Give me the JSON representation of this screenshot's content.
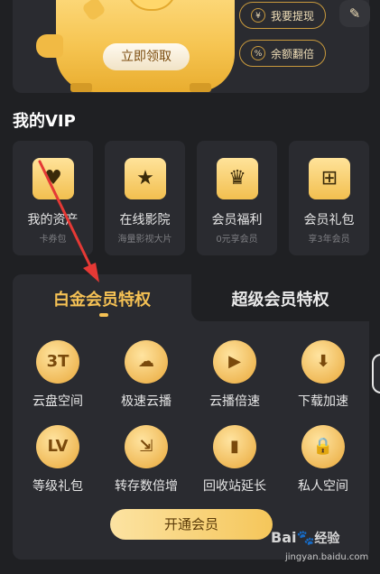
{
  "banner": {
    "claim_label": "立即领取",
    "withdraw_label": "我要提现",
    "withdraw_icon": "¥",
    "double_label": "余额翻倍",
    "double_icon": "%",
    "edit_icon": "edit-icon"
  },
  "vip": {
    "title": "我的VIP",
    "cards": [
      {
        "label": "我的资产",
        "sub": "卡券包",
        "icon": "wallet-icon"
      },
      {
        "label": "在线影院",
        "sub": "海量影视大片",
        "icon": "clapper-icon"
      },
      {
        "label": "会员福利",
        "sub": "0元享会员",
        "icon": "crown-icon"
      },
      {
        "label": "会员礼包",
        "sub": "享3年会员",
        "icon": "gift-icon"
      }
    ]
  },
  "privilege": {
    "tabs": [
      {
        "label": "白金会员特权",
        "active": true
      },
      {
        "label": "超级会员特权",
        "active": false
      }
    ],
    "features": [
      {
        "label": "云盘空间",
        "glyph": "3T"
      },
      {
        "label": "极速云播",
        "glyph": "☁"
      },
      {
        "label": "云播倍速",
        "glyph": "▶"
      },
      {
        "label": "下载加速",
        "glyph": "⬇"
      },
      {
        "label": "等级礼包",
        "glyph": "LV"
      },
      {
        "label": "转存数倍增",
        "glyph": "⇲"
      },
      {
        "label": "回收站延长",
        "glyph": "▮"
      },
      {
        "label": "私人空间",
        "glyph": "🔒"
      }
    ],
    "open_label": "开通会员"
  },
  "colors": {
    "accent_gold": "#f5c154",
    "background": "#1f2023",
    "card": "#2a2b30",
    "arrow": "#e53935"
  },
  "watermark": {
    "brand": "Bai",
    "brand2": "经验",
    "url": "jingyan.baidu.com"
  }
}
